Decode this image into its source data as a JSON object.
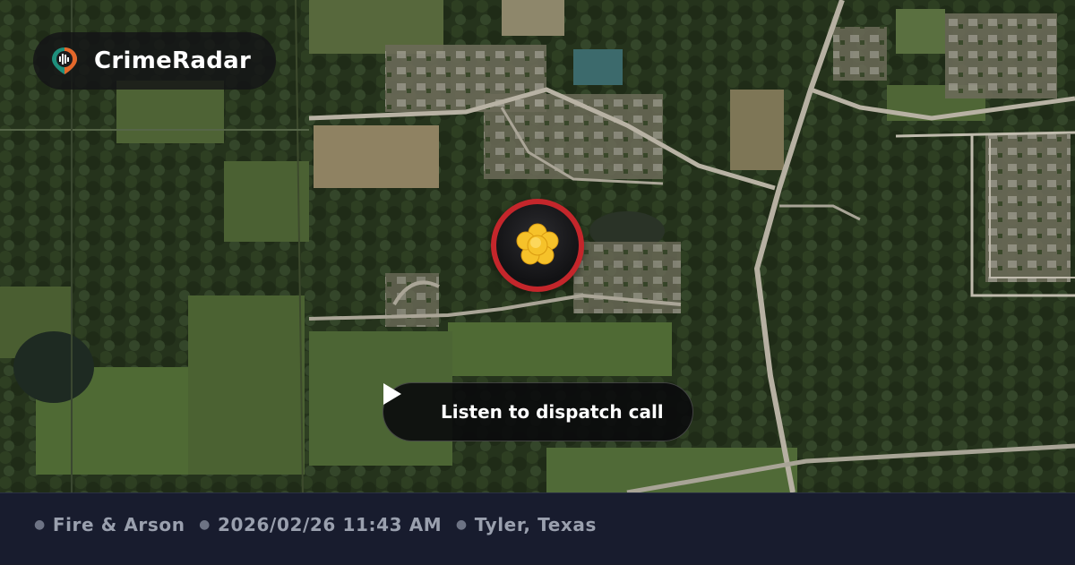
{
  "brand": {
    "name": "CrimeRadar",
    "logo_icon": "crimeradar-location-pin-icon"
  },
  "map": {
    "type": "satellite",
    "marker": {
      "category_icon": "fire-arson-icon",
      "ring_color": "#c4262b",
      "icon_color": "#f6c22a"
    }
  },
  "dispatch": {
    "button_label": "Listen to dispatch call",
    "icon": "play-icon"
  },
  "footer": {
    "category": "Fire & Arson",
    "datetime": "2026/02/26 11:43 AM",
    "location": "Tyler, Texas"
  }
}
